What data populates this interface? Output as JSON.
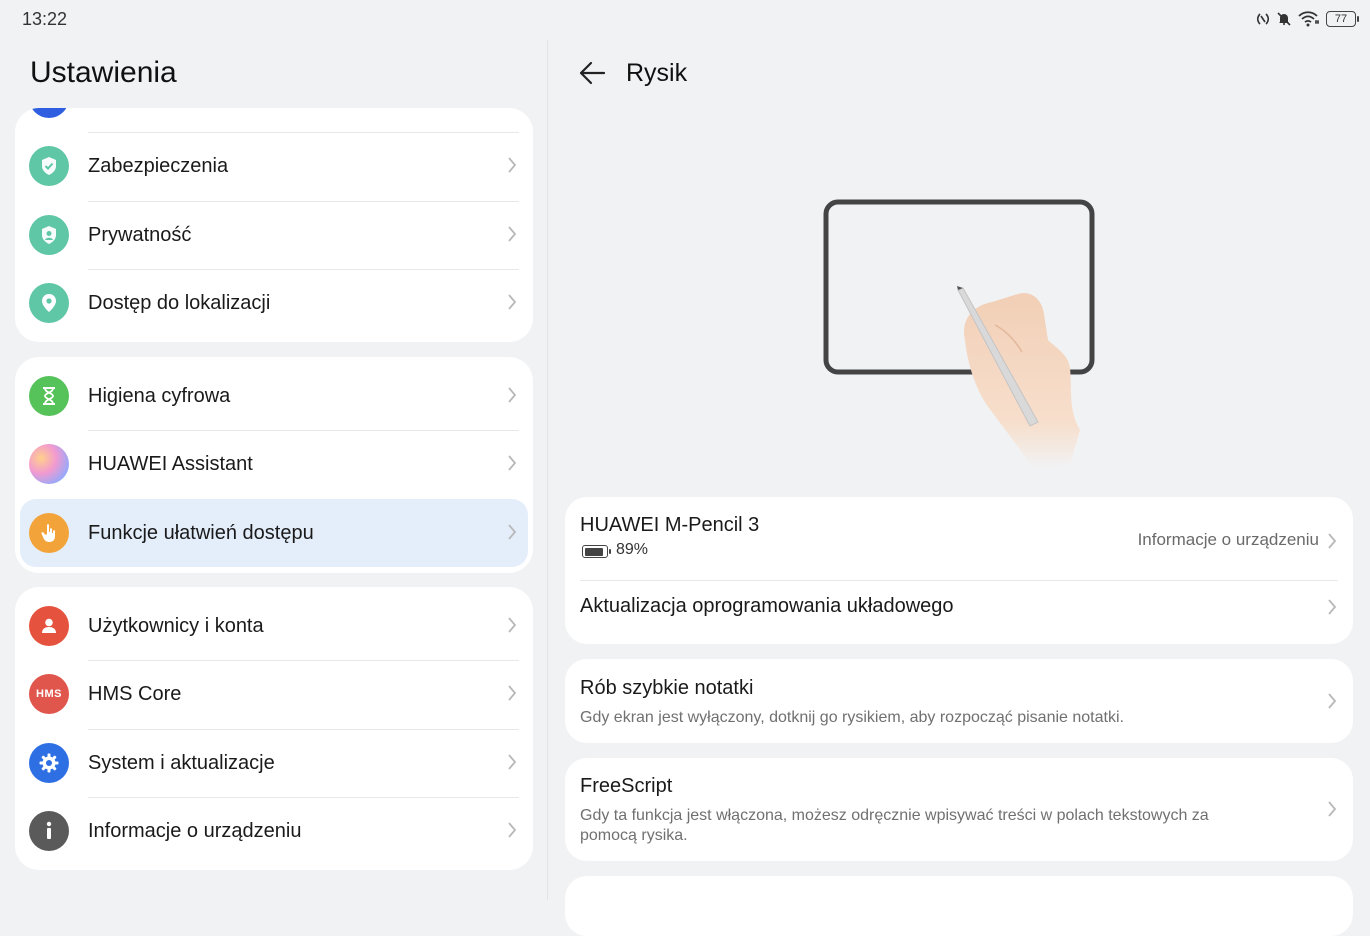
{
  "status_bar": {
    "time": "13:22",
    "battery": "77",
    "icons": [
      "nfc-icon",
      "mute-icon",
      "wifi-icon",
      "battery-icon"
    ]
  },
  "left": {
    "title": "Ustawienia",
    "groups": [
      {
        "items": [
          {
            "label": "Zabezpieczenia",
            "icon": "shield-icon",
            "color": "#5fc6a6"
          },
          {
            "label": "Prywatność",
            "icon": "privacy-icon",
            "color": "#5fc6a6"
          },
          {
            "label": "Dostęp do lokalizacji",
            "icon": "location-icon",
            "color": "#5fc6a6"
          }
        ]
      },
      {
        "items": [
          {
            "label": "Higiena cyfrowa",
            "icon": "hourglass-icon",
            "color": "#56c25a"
          },
          {
            "label": "HUAWEI Assistant",
            "icon": "assistant-icon",
            "color": "#c39af0"
          },
          {
            "label": "Funkcje ułatwień dostępu",
            "icon": "hand-icon",
            "color": "#f2a33a",
            "selected": true
          }
        ]
      },
      {
        "items": [
          {
            "label": "Użytkownicy i konta",
            "icon": "user-icon",
            "color": "#e5533f"
          },
          {
            "label": "HMS Core",
            "icon": "hms-icon",
            "color": "#e0564d",
            "icon_text": "HMS"
          },
          {
            "label": "System i aktualizacje",
            "icon": "gear-icon",
            "color": "#2f6fe4"
          },
          {
            "label": "Informacje o urządzeniu",
            "icon": "info-icon",
            "color": "#5a5a5a"
          }
        ]
      }
    ]
  },
  "right": {
    "title": "Rysik",
    "device": {
      "name": "HUAWEI M-Pencil 3",
      "battery": "89%",
      "info_link": "Informacje o urządzeniu"
    },
    "firmware": "Aktualizacja oprogramowania układowego",
    "quick_notes": {
      "title": "Rób szybkie notatki",
      "desc": "Gdy ekran jest wyłączony, dotknij go rysikiem, aby rozpocząć pisanie notatki."
    },
    "freescript": {
      "title": "FreeScript",
      "desc_line1": "Gdy ta funkcja jest włączona, możesz odręcznie wpisywać treści w polach tekstowych za",
      "desc_line2": "pomocą rysika."
    }
  }
}
